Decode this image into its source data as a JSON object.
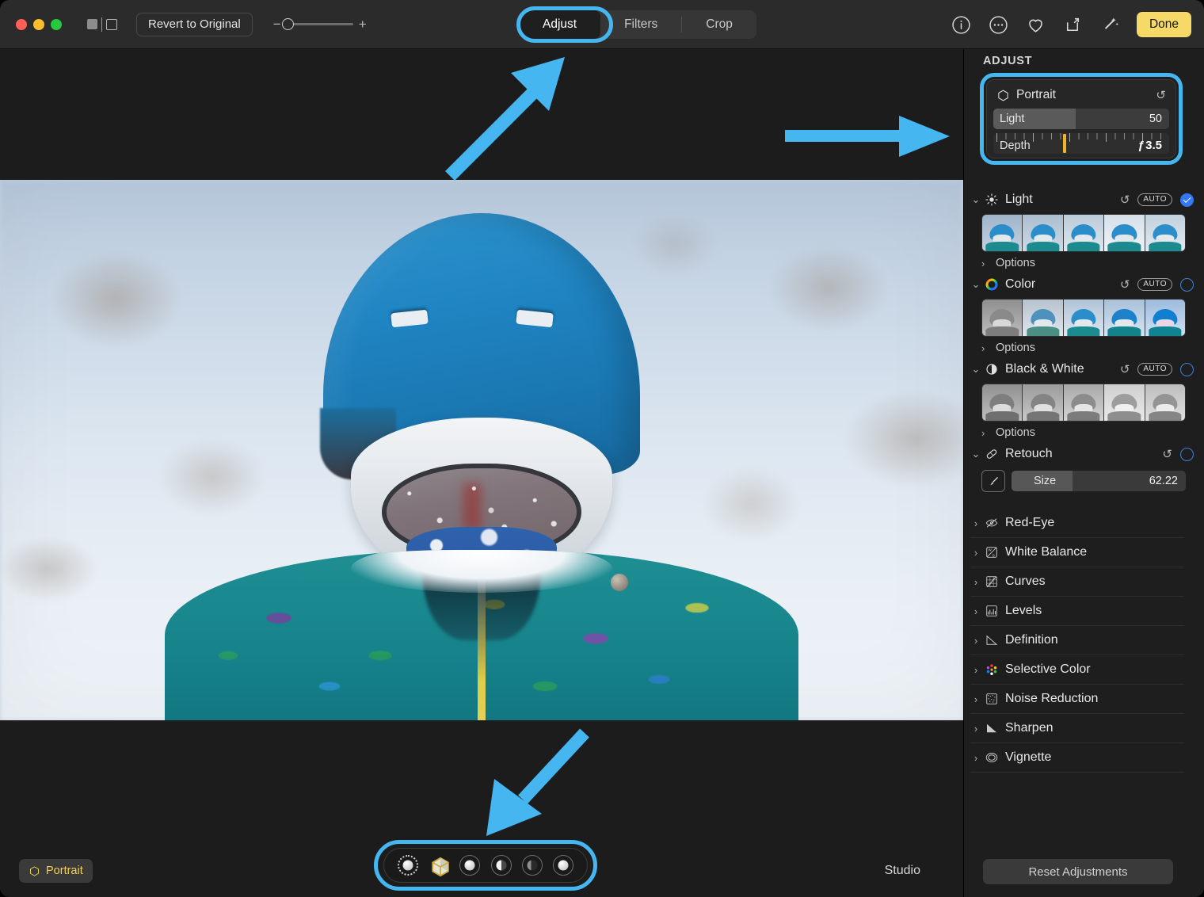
{
  "window": {
    "traffic_lights": [
      "close",
      "minimize",
      "zoom"
    ],
    "revert_label": "Revert to Original",
    "zoom_minus": "−",
    "zoom_plus": "+"
  },
  "tabs": [
    {
      "label": "Adjust",
      "active": true,
      "highlighted": true
    },
    {
      "label": "Filters",
      "active": false,
      "highlighted": false
    },
    {
      "label": "Crop",
      "active": false,
      "highlighted": false
    }
  ],
  "toolbar_right": {
    "icons": [
      "info-icon",
      "more-icon",
      "favorite-icon",
      "share-icon",
      "enhance-icon"
    ],
    "done_label": "Done"
  },
  "canvas": {
    "portrait_badge": "Portrait",
    "lighting_mode": "Studio",
    "lighting_effects": [
      {
        "name": "natural-light",
        "selected": false
      },
      {
        "name": "portrait-cube",
        "selected": true
      },
      {
        "name": "studio-light",
        "selected": false
      },
      {
        "name": "contour-light",
        "selected": false
      },
      {
        "name": "stage-light",
        "selected": false
      },
      {
        "name": "stage-light-mono",
        "selected": false
      }
    ]
  },
  "panel": {
    "title": "ADJUST",
    "portrait": {
      "title": "Portrait",
      "reset_glyph": "↺",
      "light": {
        "label": "Light",
        "value": "50",
        "fill_percent": 47
      },
      "depth": {
        "label": "Depth",
        "value": "ƒ 3.5",
        "marker_percent": 38
      }
    },
    "sections": [
      {
        "label": "Light",
        "icon": "sun-icon",
        "expanded": true,
        "auto_label": "AUTO",
        "reset_glyph": "↺",
        "enabled": true,
        "options_label": "Options",
        "thumbnails": 5,
        "playhead_percent": 60
      },
      {
        "label": "Color",
        "icon": "color-wheel-icon",
        "expanded": true,
        "auto_label": "AUTO",
        "reset_glyph": "↺",
        "enabled": false,
        "options_label": "Options",
        "thumbnails": 5,
        "playhead_percent": 60
      },
      {
        "label": "Black & White",
        "icon": "contrast-icon",
        "expanded": true,
        "auto_label": "AUTO",
        "reset_glyph": "↺",
        "enabled": false,
        "options_label": "Options",
        "thumbnails": 5,
        "playhead_percent": 60
      }
    ],
    "retouch": {
      "label": "Retouch",
      "icon": "bandage-icon",
      "reset_glyph": "↺",
      "enabled": false,
      "size_label": "Size",
      "size_value": "62.22",
      "size_fill_percent": 35
    },
    "simple_rows": [
      {
        "label": "Red-Eye",
        "icon": "eye-slash-icon"
      },
      {
        "label": "White Balance",
        "icon": "white-balance-icon"
      },
      {
        "label": "Curves",
        "icon": "curves-icon"
      },
      {
        "label": "Levels",
        "icon": "levels-icon"
      },
      {
        "label": "Definition",
        "icon": "definition-icon"
      },
      {
        "label": "Selective Color",
        "icon": "selective-color-icon"
      },
      {
        "label": "Noise Reduction",
        "icon": "noise-reduction-icon"
      },
      {
        "label": "Sharpen",
        "icon": "sharpen-icon"
      },
      {
        "label": "Vignette",
        "icon": "vignette-icon"
      }
    ],
    "reset_adjustments_label": "Reset Adjustments"
  },
  "annotations": {
    "highlight_color": "#45b6f0",
    "arrows": [
      {
        "name": "arrow-to-adjust-tab",
        "direction": "up-right"
      },
      {
        "name": "arrow-to-portrait-panel",
        "direction": "right"
      },
      {
        "name": "arrow-to-lighting-strip",
        "direction": "down-left"
      }
    ],
    "highlights": [
      {
        "name": "adjust-tab-highlight"
      },
      {
        "name": "portrait-panel-highlight"
      },
      {
        "name": "lighting-strip-highlight"
      }
    ]
  }
}
